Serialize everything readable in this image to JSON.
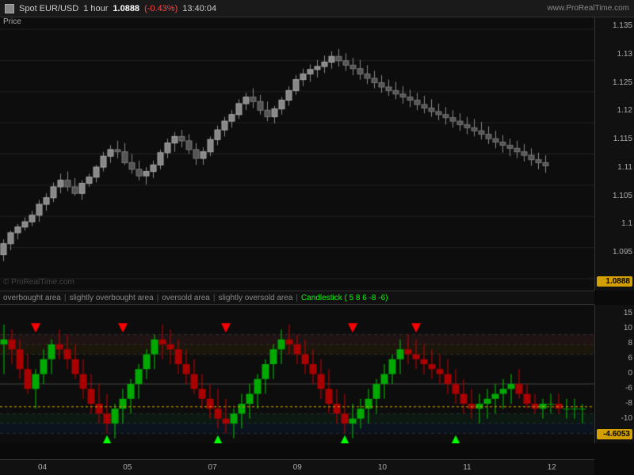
{
  "header": {
    "symbol": "Spot EUR/USD",
    "timeframe": "1 hour",
    "price": "1.0888",
    "change": "(-0.43%)",
    "time": "13:40:04",
    "website": "www.ProRealTime.com"
  },
  "price_axis": {
    "labels": [
      "1.135",
      "1.13",
      "1.125",
      "1.12",
      "1.115",
      "1.11",
      "1.105",
      "1.1",
      "1.095"
    ],
    "active": "1.0888"
  },
  "osc_axis": {
    "labels": [
      "15",
      "10",
      "8",
      "6",
      "0",
      "-6",
      "-8",
      "-10"
    ],
    "active": "-4.6053"
  },
  "legend": {
    "items": [
      "overbought area",
      "slightly overbought area",
      "oversold area",
      "slightly oversold area"
    ],
    "candlestick_label": "Candlestick ( 5 8 6 -8 -6)"
  },
  "x_axis": {
    "labels": [
      "04",
      "05",
      "07",
      "09",
      "10",
      "11",
      "12"
    ]
  },
  "watermark": "© ProRealTime.com",
  "price_label": "Price"
}
